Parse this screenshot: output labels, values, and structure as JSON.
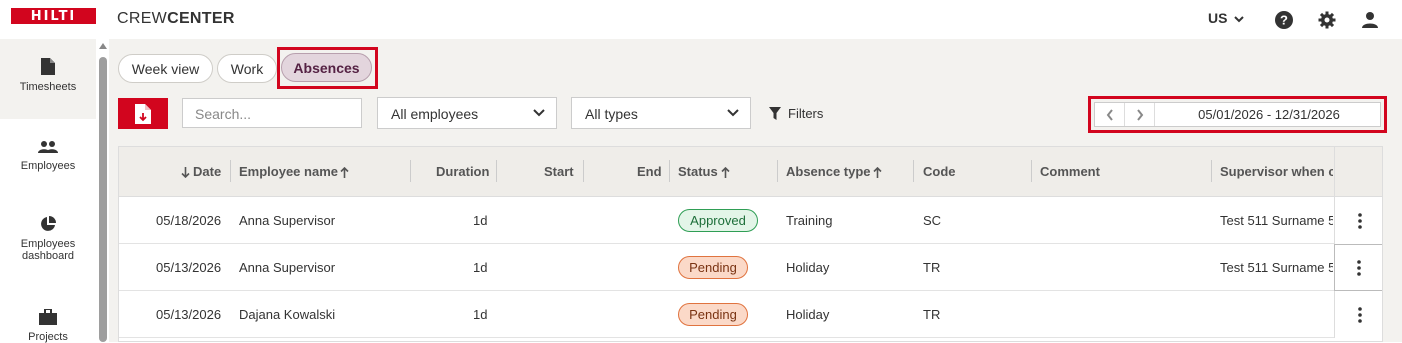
{
  "header": {
    "logo_text": "HILTI",
    "app_title_prefix": "CREW",
    "app_title_suffix": "CENTER",
    "language": "US",
    "brand_color": "#d2051e"
  },
  "sidebar": {
    "items": [
      {
        "label": "Timesheets",
        "icon": "document-icon"
      },
      {
        "label": "Employees",
        "icon": "people-icon"
      },
      {
        "label": "Employees",
        "label2": "dashboard",
        "icon": "pie-chart-icon"
      },
      {
        "label": "Projects",
        "icon": "briefcase-icon"
      }
    ]
  },
  "tabs": [
    {
      "label": "Week view"
    },
    {
      "label": "Work"
    },
    {
      "label": "Absences",
      "active": true
    }
  ],
  "toolbar": {
    "search_placeholder": "Search...",
    "employees_select": "All employees",
    "types_select": "All types",
    "filters_label": "Filters",
    "date_range": "05/01/2026 - 12/31/2026"
  },
  "table": {
    "columns": [
      "Date",
      "Employee name",
      "Duration",
      "Start",
      "End",
      "Status",
      "Absence type",
      "Code",
      "Comment",
      "Supervisor when cr"
    ],
    "rows": [
      {
        "date": "05/18/2026",
        "employee": "Anna Supervisor",
        "duration": "1d",
        "start": "",
        "end": "",
        "status": "Approved",
        "absence_type": "Training",
        "code": "SC",
        "comment": "",
        "supervisor": "Test 511 Surname 5"
      },
      {
        "date": "05/13/2026",
        "employee": "Anna Supervisor",
        "duration": "1d",
        "start": "",
        "end": "",
        "status": "Pending",
        "absence_type": "Holiday",
        "code": "TR",
        "comment": "",
        "supervisor": "Test 511 Surname 5"
      },
      {
        "date": "05/13/2026",
        "employee": "Dajana Kowalski",
        "duration": "1d",
        "start": "",
        "end": "",
        "status": "Pending",
        "absence_type": "Holiday",
        "code": "TR",
        "comment": "",
        "supervisor": ""
      }
    ]
  }
}
